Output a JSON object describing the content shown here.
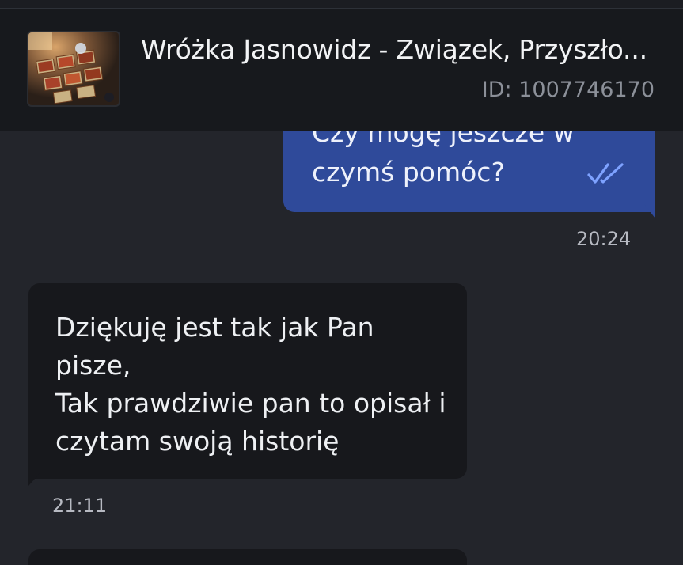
{
  "chat": {
    "title": "Wróżka Jasnowidz - Związek, Przyszło...",
    "id_label": "ID: 1007746170"
  },
  "messages": [
    {
      "direction": "outgoing",
      "lines": [
        "Czy mogę jeszcze w",
        "czymś pomóc?"
      ],
      "time": "20:24",
      "status_icon": "double-check-icon"
    },
    {
      "direction": "incoming",
      "lines": [
        "Dziękuję jest tak jak Pan",
        "pisze,",
        "Tak prawdziwie pan to opisał i",
        "czytam swoją historię"
      ],
      "time": "21:11"
    }
  ],
  "colors": {
    "background": "#23252b",
    "header": "#17191d",
    "outgoing_bubble": "#2f4a9a",
    "incoming_bubble": "#17181c",
    "read_check": "#7ea2ff"
  }
}
